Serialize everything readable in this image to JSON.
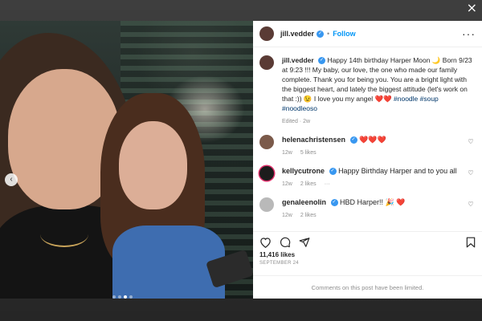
{
  "close_label": "×",
  "media": {
    "prev_arrow": "‹",
    "carousel_count": 4,
    "carousel_active_index": 2
  },
  "header": {
    "username": "jill.vedder",
    "separator": "•",
    "follow_label": "Follow",
    "more_label": "···"
  },
  "caption": {
    "username": "jill.vedder",
    "text": "Happy 14th birthday Harper Moon 🌙 Born 9/23 at 9:23 !!! My baby, our love, the one who made our family complete. Thank you for being you. You are a bright light with the biggest heart, and lately the biggest attitude (let's work on that :)) 😉 I love you my angel ❤️❤️",
    "hashtags": "#noodle #soup #noodleoso",
    "meta": "Edited · 2w"
  },
  "comments": [
    {
      "username": "helenachristensen",
      "text": "❤️❤️❤️",
      "age": "12w",
      "likes": "5 likes",
      "reply": "",
      "more": ""
    },
    {
      "username": "kellycutrone",
      "text": "Happy Birthday Harper and to you all",
      "age": "12w",
      "likes": "2 likes",
      "reply": "",
      "more": "···"
    },
    {
      "username": "genaleenolin",
      "text": "HBD Harper!! 🎉 ❤️",
      "age": "12w",
      "likes": "2 likes",
      "reply": "",
      "more": ""
    }
  ],
  "actions": {
    "likes": "11,416 likes",
    "date": "SEPTEMBER 24"
  },
  "footer": {
    "text": "Comments on this post have been limited."
  },
  "colors": {
    "follow": "#0095f6",
    "hashtag": "#00376b",
    "verified": "#3897f0"
  }
}
